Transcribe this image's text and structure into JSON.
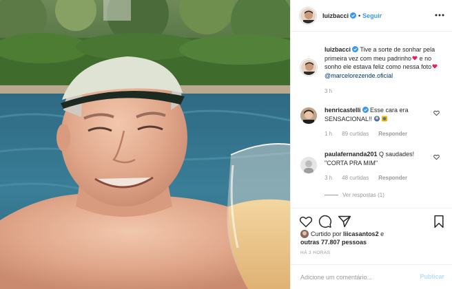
{
  "post": {
    "author": "luizbacci",
    "follow_label": "Seguir",
    "dot": "•"
  },
  "caption": {
    "username": "luizbacci",
    "text": "Tive a sorte de sonhar pela primeira vez com meu padrinho",
    "text2": "e no sonho ele estava feliz como nessa foto",
    "mention": "@marcelorezende.oficial",
    "time": "3 h"
  },
  "comments": [
    {
      "username": "henricastelli",
      "text": "Esse cara era SENSACIONAL!!",
      "time": "1 h",
      "likes": "89 curtidas",
      "reply": "Responder"
    },
    {
      "username": "paulafernanda201",
      "text": "Q saudades! \"CORTA PRA MIM\"",
      "time": "3 h",
      "likes": "48 curtidas",
      "reply": "Responder"
    }
  ],
  "view_replies": "Ver respostas (1)",
  "likes": {
    "prefix": "Curtido por",
    "user": "liicasantos2",
    "middle": "e",
    "others": "outras 77.807 pessoas"
  },
  "timestamp": "HÁ 3 HORAS",
  "comment_box": {
    "placeholder": "Adicione um comentário...",
    "publish_label": "Publicar"
  },
  "colors": {
    "link": "#3897f0",
    "publish_disabled": "#b2dffc",
    "muted": "#999999",
    "text": "#262626",
    "verified": "#3897f0",
    "heart_emoji": "#e0245e"
  },
  "icons": [
    "verified-badge-icon",
    "more-options-icon",
    "heart-icon",
    "comment-icon",
    "share-icon",
    "bookmark-icon",
    "small-heart-icon"
  ]
}
